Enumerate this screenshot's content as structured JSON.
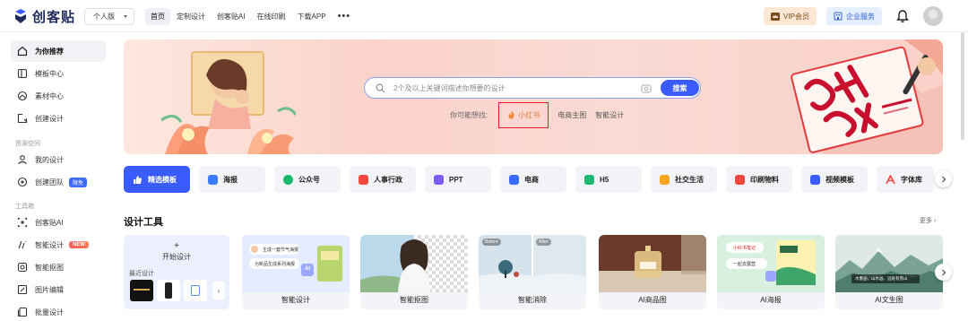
{
  "brand": {
    "name": "创客贴",
    "accent": "#3a5bff"
  },
  "edition": {
    "label": "个人版"
  },
  "nav": {
    "items": [
      "首页",
      "定制设计",
      "创客贴AI",
      "在线印刷",
      "下载APP"
    ],
    "active_index": 0
  },
  "header": {
    "vip_label": "VIP会员",
    "enterprise_label": "企业服务",
    "bell_icon": "bell-icon",
    "avatar_icon": "avatar"
  },
  "sidebar": {
    "items": [
      {
        "label": "为你推荐",
        "icon": "home-icon",
        "active": true
      },
      {
        "label": "模板中心",
        "icon": "template-icon"
      },
      {
        "label": "素材中心",
        "icon": "material-icon"
      },
      {
        "label": "创建设计",
        "icon": "create-icon"
      }
    ],
    "section_resources": "资源空间",
    "resource_items": [
      {
        "label": "我的设计",
        "icon": "user-icon"
      },
      {
        "label": "创建团队",
        "icon": "team-icon",
        "badge": "限免"
      }
    ],
    "section_tools": "工具箱",
    "tool_items": [
      {
        "label": "创客贴AI",
        "icon": "ai-icon"
      },
      {
        "label": "智能设计",
        "icon": "smart-design-icon",
        "badge": "NEW"
      },
      {
        "label": "智能抠图",
        "icon": "cutout-icon"
      },
      {
        "label": "图片编辑",
        "icon": "image-edit-icon"
      },
      {
        "label": "批量设计",
        "icon": "batch-icon"
      }
    ]
  },
  "banner": {
    "search_placeholder": "2个及以上关键词描述你想要的设计",
    "search_button": "搜索",
    "suggest_prefix": "你可能想找:",
    "suggest_items": [
      "小红书",
      "电商主图",
      "智能设计"
    ]
  },
  "categories": [
    {
      "label": "精选模板",
      "color": "#ffffff",
      "active": true
    },
    {
      "label": "海报",
      "color": "#3a7bff"
    },
    {
      "label": "公众号",
      "color": "#19b86b"
    },
    {
      "label": "人事行政",
      "color": "#f0483e"
    },
    {
      "label": "PPT",
      "color": "#7a5cff"
    },
    {
      "label": "电商",
      "color": "#3a6bff"
    },
    {
      "label": "H5",
      "color": "#1fb870"
    },
    {
      "label": "社交生活",
      "color": "#f5a623"
    },
    {
      "label": "印刷物料",
      "color": "#f0483e"
    },
    {
      "label": "视频模板",
      "color": "#3a5bff"
    },
    {
      "label": "字体库",
      "color": "#f0483e"
    }
  ],
  "tools": {
    "title": "设计工具",
    "more_label": "更多",
    "start": {
      "plus": "+",
      "label": "开始设计",
      "recent_label": "最近设计"
    },
    "cards": [
      {
        "label": "智能设计",
        "tag1": "生成一套节气海报",
        "tag2": "为新品生成系列海报",
        "tag3": "AI"
      },
      {
        "label": "智能抠图"
      },
      {
        "label": "智能消除",
        "before": "Before",
        "after": "After"
      },
      {
        "label": "AI商品图"
      },
      {
        "label": "AI海报",
        "tag1": "小红书笔记",
        "tag2": "一起去露营"
      },
      {
        "label": "AI文生图",
        "tag1": "水墨画，山水画，远处有雪山"
      }
    ]
  }
}
